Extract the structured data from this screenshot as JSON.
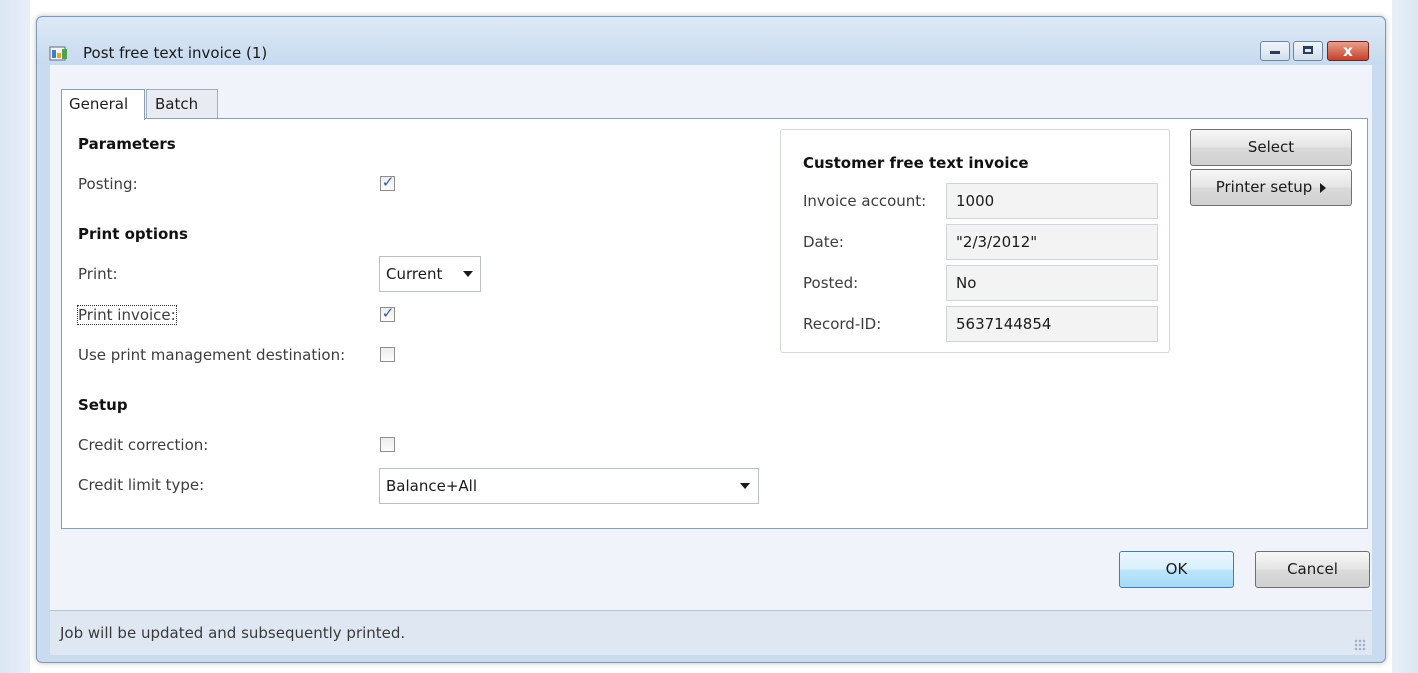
{
  "window": {
    "title": "Post free text invoice (1)",
    "controls": {
      "minimize": "minimize",
      "maximize": "maximize",
      "close": "x"
    }
  },
  "tabs": [
    {
      "label": "General",
      "active": true
    },
    {
      "label": "Batch",
      "active": false
    }
  ],
  "parameters": {
    "heading": "Parameters",
    "posting": {
      "label": "Posting:",
      "checked": true
    }
  },
  "print_options": {
    "heading": "Print options",
    "print": {
      "label": "Print:",
      "value": "Current"
    },
    "print_invoice": {
      "label": "Print invoice:",
      "checked": true
    },
    "use_print_mgmt": {
      "label": "Use print management destination:",
      "checked": false
    }
  },
  "setup": {
    "heading": "Setup",
    "credit_correction": {
      "label": "Credit correction:",
      "checked": false
    },
    "credit_limit_type": {
      "label": "Credit limit type:",
      "value": "Balance+All"
    }
  },
  "invoice_info": {
    "heading": "Customer free text invoice",
    "fields": [
      {
        "label": "Invoice account:",
        "value": "1000"
      },
      {
        "label": "Date:",
        "value": "\"2/3/2012\""
      },
      {
        "label": "Posted:",
        "value": "No"
      },
      {
        "label": "Record-ID:",
        "value": "5637144854"
      }
    ]
  },
  "side_buttons": {
    "select": "Select",
    "printer_setup": "Printer setup"
  },
  "footer_buttons": {
    "ok": "OK",
    "cancel": "Cancel"
  },
  "status": {
    "text": "Job will be updated and subsequently printed."
  },
  "icons": {
    "app": "dialog-app-icon",
    "checkbox_tick": "✓",
    "dropdown": "chevron-down-icon",
    "submenu": "triangle-right-icon"
  }
}
